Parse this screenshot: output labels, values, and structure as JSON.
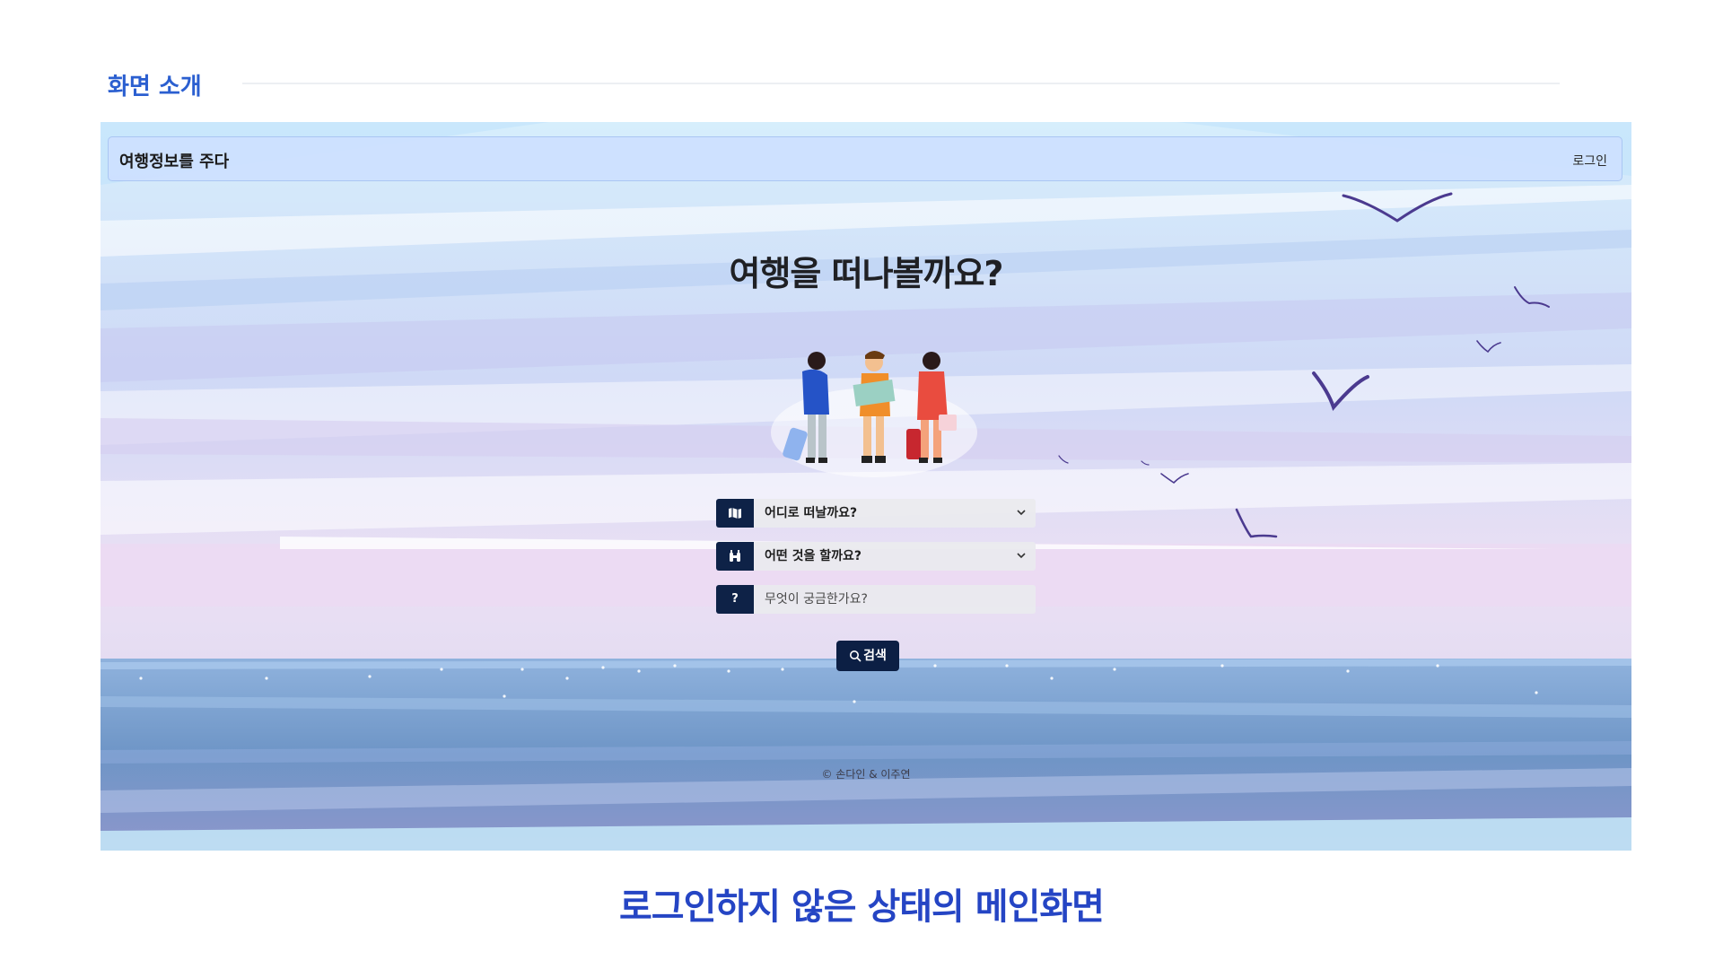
{
  "slide": {
    "section_title": "화면 소개",
    "caption": "로그인하지 않은 상태의 메인화면"
  },
  "app": {
    "brand": "여행정보를 주다",
    "login_label": "로그인",
    "hero_title": "여행을 떠나볼까요?",
    "fields": [
      {
        "icon": "map-icon",
        "label": "어디로 떠날까요?",
        "type": "select"
      },
      {
        "icon": "binoculars-icon",
        "label": "어떤 것을 할까요?",
        "type": "select"
      },
      {
        "icon": "question-icon",
        "icon_text": "?",
        "placeholder": "무엇이 궁금한가요?",
        "type": "input"
      }
    ],
    "search_label": "검색",
    "footer": "© 손다인 & 이주연"
  },
  "colors": {
    "accent": "#2b5fd0",
    "caption": "#2545c4",
    "navy": "#0e2247",
    "navbar": "#cde0ff"
  }
}
